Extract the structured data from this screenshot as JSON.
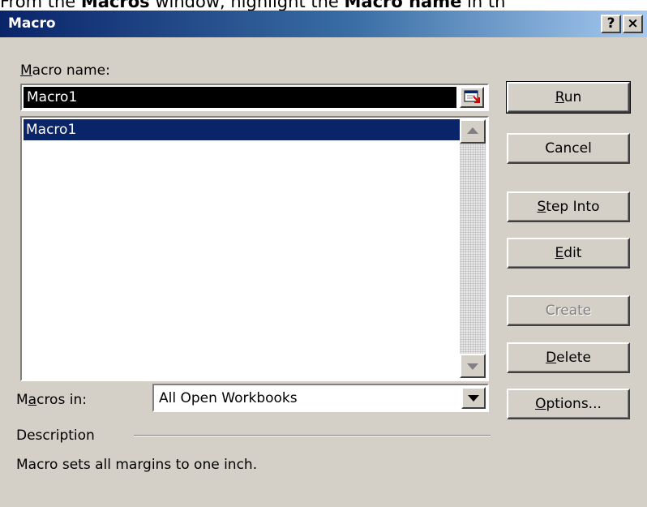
{
  "instruction": {
    "prefix": "From the ",
    "bold1": "Macros",
    "middle": " window, highlight the ",
    "bold2": "Macro name",
    "suffix": " in th"
  },
  "window": {
    "title": "Macro",
    "help_glyph": "?",
    "close_glyph": "×"
  },
  "macro_name": {
    "label_acc": "M",
    "label_rest": "acro name:",
    "value": "Macro1"
  },
  "macro_list": {
    "items": [
      "Macro1"
    ],
    "selected_index": 0
  },
  "macros_in": {
    "label_pre": "M",
    "label_acc": "a",
    "label_rest": "cros in:",
    "value": "All Open Workbooks"
  },
  "description": {
    "label": "Description",
    "text": "Macro sets all margins to one inch."
  },
  "buttons": {
    "run": {
      "acc": "R",
      "rest": "un"
    },
    "cancel": {
      "label": "Cancel"
    },
    "step_into": {
      "acc": "S",
      "rest": "tep Into"
    },
    "edit": {
      "acc": "E",
      "rest": "dit"
    },
    "create": {
      "label": "Create"
    },
    "delete": {
      "acc": "D",
      "rest": "elete"
    },
    "options": {
      "acc": "O",
      "rest": "ptions..."
    }
  },
  "icons": {
    "collapse": "collapse-dialog-icon",
    "scroll_up": "triangle-up-icon",
    "scroll_down": "triangle-down-icon",
    "dropdown": "triangle-down-icon"
  },
  "colors": {
    "title_start": "#0a246a",
    "title_end": "#a6caf0",
    "selection": "#0a246a",
    "face": "#d4d0c8"
  }
}
